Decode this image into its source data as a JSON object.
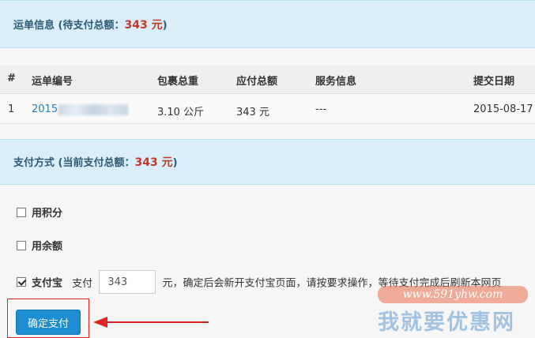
{
  "waybill_panel": {
    "title_prefix": "运单信息 (待支付总额：",
    "amount": "343 元",
    "title_suffix": ")"
  },
  "table": {
    "headers": [
      "#",
      "运单编号",
      "包裹总重",
      "应付总额",
      "服务信息",
      "提交日期"
    ],
    "rows": [
      {
        "index": "1",
        "waybill_no_visible": "2015",
        "weight": "3.10 公斤",
        "total": "343 元",
        "service": "---",
        "date": "2015-08-17"
      }
    ]
  },
  "payment_panel": {
    "title_prefix": "支付方式 (当前支付总额：",
    "amount": "343 元",
    "title_suffix": ")"
  },
  "options": {
    "points": {
      "label": "用积分",
      "checked": false
    },
    "balance": {
      "label": "用余额",
      "checked": false
    },
    "alipay": {
      "label": "支付宝",
      "checked": true,
      "pay_prefix": "支付",
      "amount_value": "343",
      "pay_suffix": "元，确定后会新开支付宝页面，请按要求操作，等待支付完成后刷新本网页"
    }
  },
  "confirm_button": {
    "label": "确定支付"
  },
  "watermark": {
    "url": "www.591yhw.com",
    "text": "我就要优惠网"
  },
  "colors": {
    "accent": "#1d8ed1",
    "amount": "#c0392b",
    "panel_bg": "#d9eef8",
    "highlight": "#e02222"
  }
}
